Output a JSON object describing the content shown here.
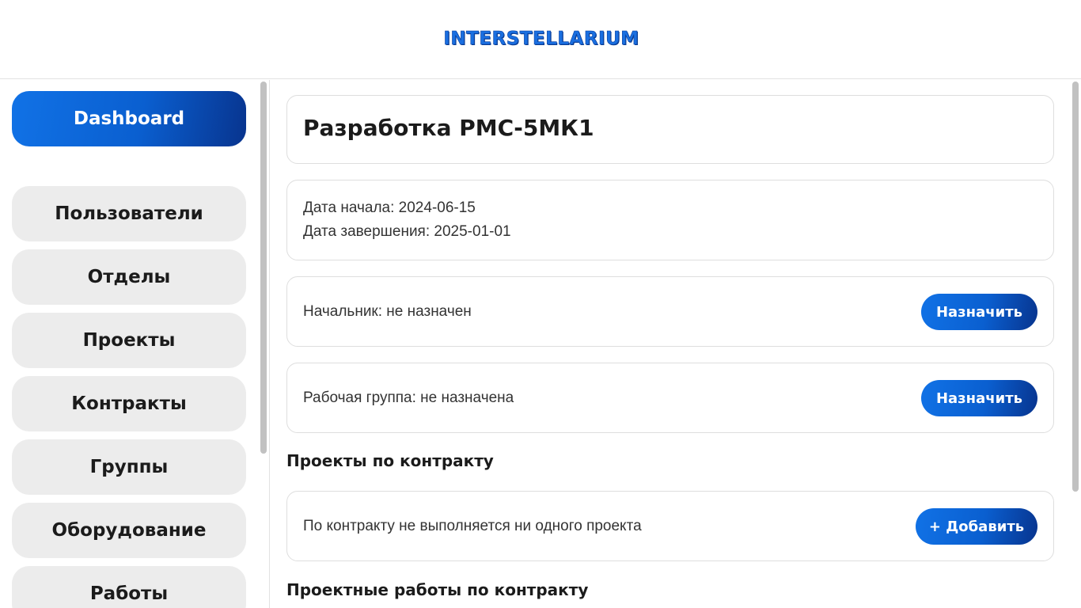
{
  "header": {
    "logo_text": "INTERSTELLARIUM"
  },
  "sidebar": {
    "items": [
      {
        "label": "Dashboard",
        "active": true
      },
      {
        "label": "Пользователи"
      },
      {
        "label": "Отделы"
      },
      {
        "label": "Проекты"
      },
      {
        "label": "Контракты"
      },
      {
        "label": "Группы"
      },
      {
        "label": "Оборудование"
      },
      {
        "label": "Работы"
      }
    ]
  },
  "contract": {
    "title": "Разработка РМС-5МК1",
    "start_date": "Дата начала: 2024-06-15",
    "end_date": "Дата завершения: 2025-01-01",
    "manager": "Начальник: не назначен",
    "manager_button": "Назначить",
    "group": "Рабочая группа: не назначена",
    "group_button": "Назначить"
  },
  "projects_section": {
    "title": "Проекты по контракту",
    "empty_text": "По контракту не выполняется ни одного проекта",
    "add_button": "+ Добавить"
  },
  "works_section": {
    "title": "Проектные работы по контракту"
  },
  "colors": {
    "accent_start": "#1172e6",
    "accent_end": "#08348e",
    "nav_bg": "#ececec"
  }
}
